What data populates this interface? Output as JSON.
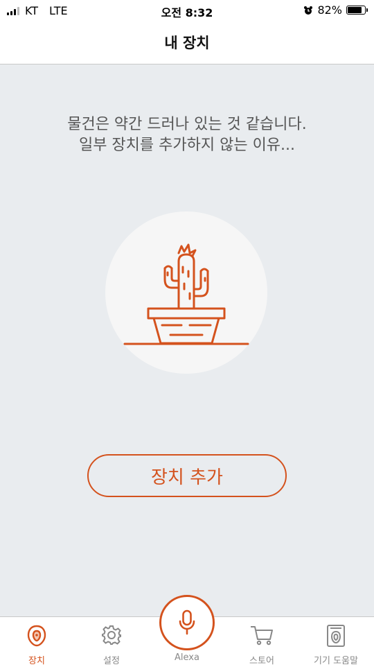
{
  "status": {
    "carrier": "KT",
    "network": "LTE",
    "time": "오전 8:32",
    "battery": "82%",
    "battery_level": 0.82,
    "alarm_icon": "alarm-clock-icon"
  },
  "nav": {
    "title": "내 장치"
  },
  "empty_state": {
    "line1": "물건은 약간 드러나 있는 것 같습니다.",
    "line2": "일부 장치를 추가하지 않는 이유...",
    "illustration": "cactus-illustration"
  },
  "add_device_label": "장치 추가",
  "tabs": [
    {
      "label": "장치",
      "icon": "devices-icon",
      "active": true
    },
    {
      "label": "설정",
      "icon": "gear-icon",
      "active": false
    },
    {
      "label": "Alexa",
      "icon": "microphone-icon",
      "active": false
    },
    {
      "label": "스토어",
      "icon": "cart-icon",
      "active": false
    },
    {
      "label": "기기 도움말",
      "icon": "help-device-icon",
      "active": false
    }
  ],
  "colors": {
    "accent": "#d4521d",
    "background": "#e9ecef",
    "inactive": "#888888"
  }
}
